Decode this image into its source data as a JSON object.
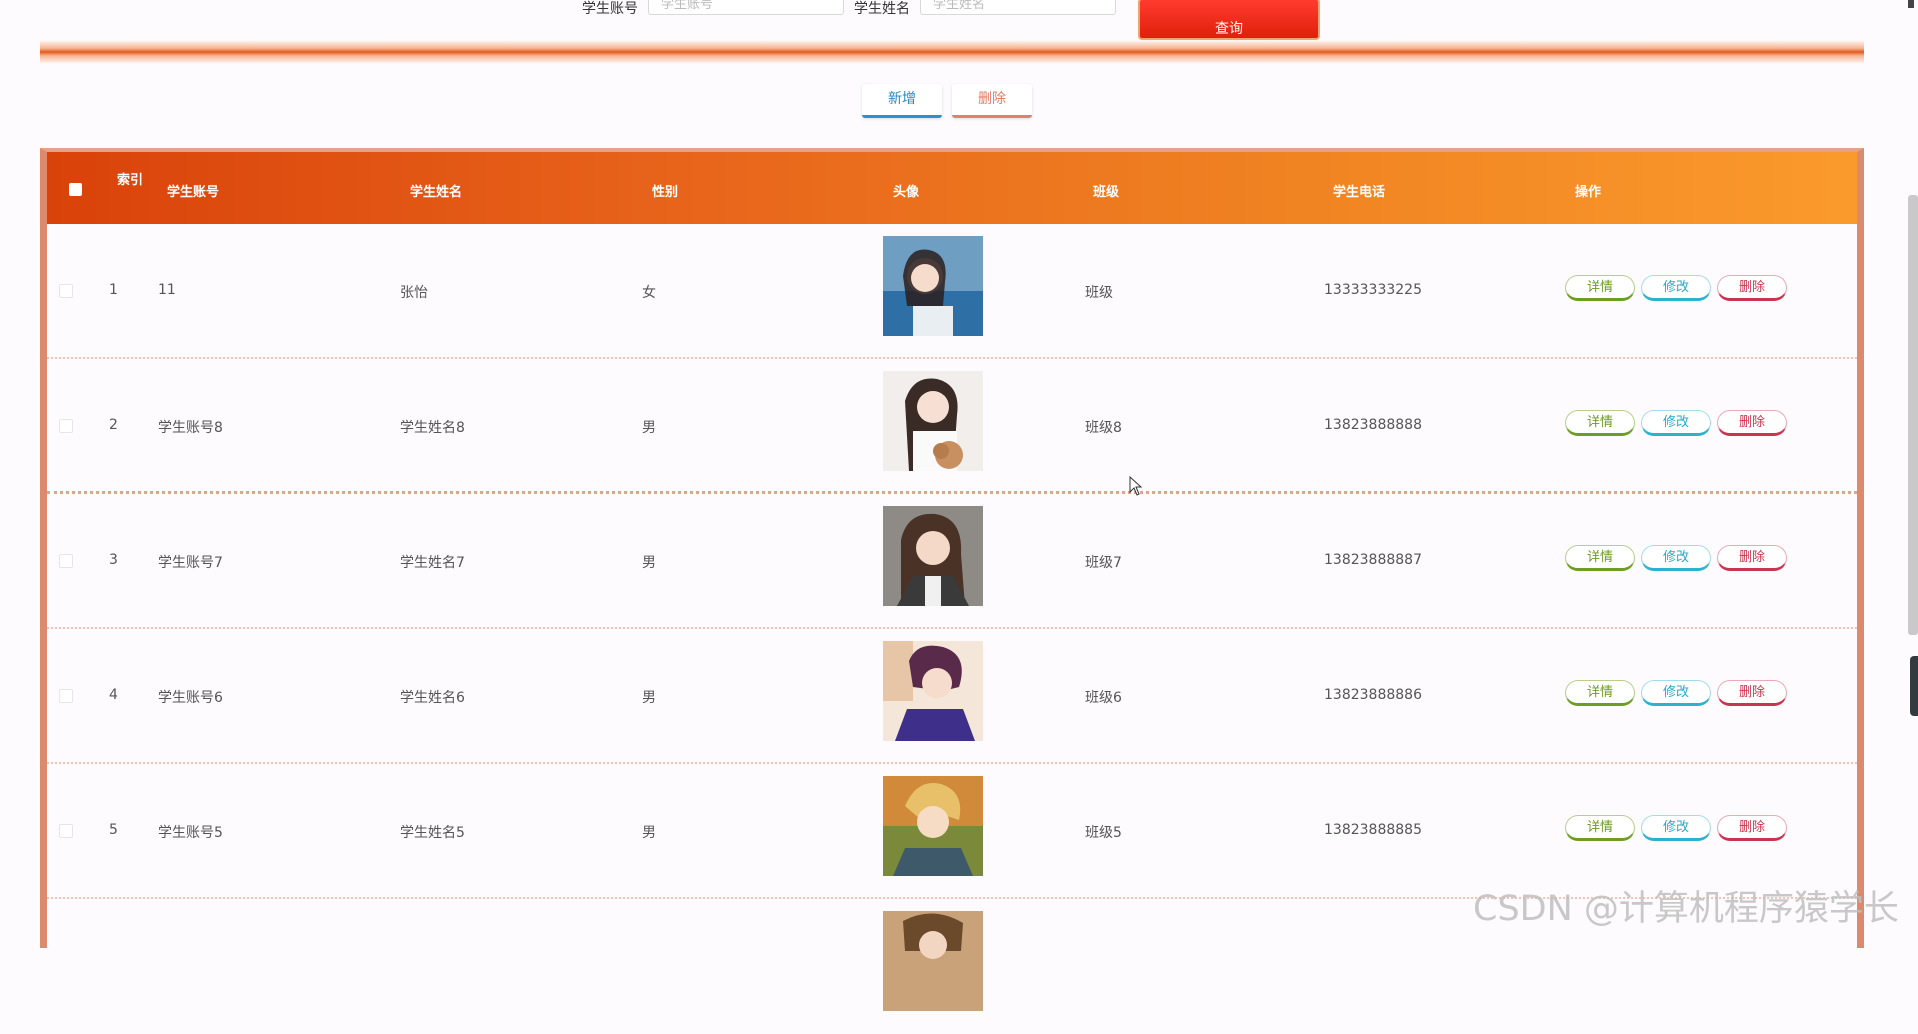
{
  "search": {
    "account_label": "学生账号",
    "account_placeholder": "学生账号",
    "name_label": "学生姓名",
    "name_placeholder": "学生姓名",
    "query_button": "查询"
  },
  "actions": {
    "add": "新增",
    "delete": "删除"
  },
  "table": {
    "headers": {
      "index": "索引",
      "account": "学生账号",
      "name": "学生姓名",
      "gender": "性别",
      "avatar": "头像",
      "class": "班级",
      "phone": "学生电话",
      "ops": "操作"
    },
    "ops": {
      "detail": "详情",
      "edit": "修改",
      "delete": "删除"
    },
    "rows": [
      {
        "index": "1",
        "account": "11",
        "name": "张怡",
        "gender": "女",
        "class": "班级",
        "phone": "13333333225"
      },
      {
        "index": "2",
        "account": "学生账号8",
        "name": "学生姓名8",
        "gender": "男",
        "class": "班级8",
        "phone": "13823888888"
      },
      {
        "index": "3",
        "account": "学生账号7",
        "name": "学生姓名7",
        "gender": "男",
        "class": "班级7",
        "phone": "13823888887"
      },
      {
        "index": "4",
        "account": "学生账号6",
        "name": "学生姓名6",
        "gender": "男",
        "class": "班级6",
        "phone": "13823888886"
      },
      {
        "index": "5",
        "account": "学生账号5",
        "name": "学生姓名5",
        "gender": "男",
        "class": "班级5",
        "phone": "13823888885"
      }
    ]
  },
  "watermark": "CSDN @计算机程序猿学长",
  "colors": {
    "header_start": "#d9420a",
    "header_end": "#fb9a2c",
    "add_accent": "#2b8fd6",
    "delete_accent": "#e4806a",
    "detail_accent": "#6d9e22",
    "edit_accent": "#2bb2cc",
    "row_delete_accent": "#c93550"
  }
}
